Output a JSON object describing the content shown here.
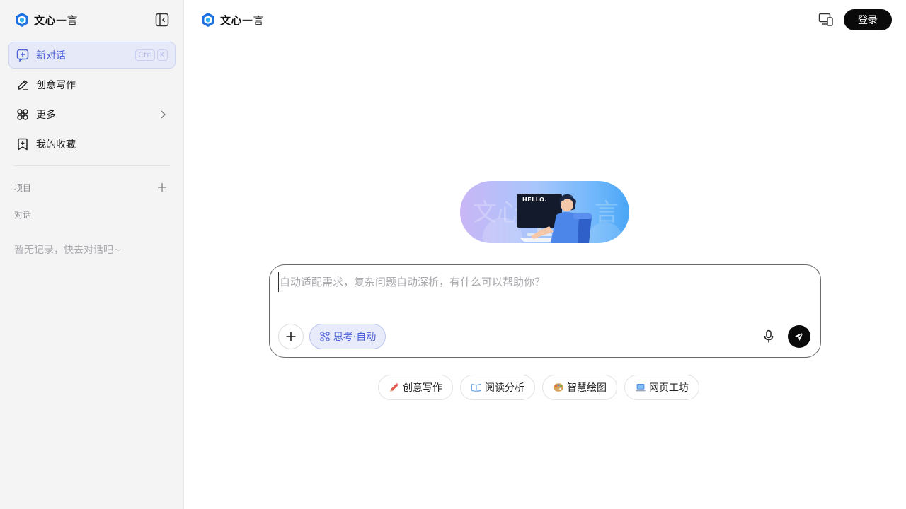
{
  "brand": {
    "name_bold": "文心",
    "name_light": "一言"
  },
  "sidebar": {
    "items": [
      {
        "label": "新对话",
        "icon": "new-chat-icon",
        "shortcut": [
          "Ctrl",
          "K"
        ]
      },
      {
        "label": "创意写作",
        "icon": "pen-icon"
      },
      {
        "label": "更多",
        "icon": "command-icon"
      },
      {
        "label": "我的收藏",
        "icon": "bookmark-add-icon"
      }
    ],
    "projects_label": "项目",
    "chats_label": "对话",
    "empty_text": "暂无记录，快去对话吧~"
  },
  "header": {
    "login_label": "登录"
  },
  "hero": {
    "speech_text": "HELLO."
  },
  "composer": {
    "placeholder": "自动适配需求，复杂问题自动深析，有什么可以帮助你？",
    "mode_label": "思考·自动"
  },
  "suggestions": [
    {
      "label": "创意写作",
      "icon": "pencil-emoji-icon"
    },
    {
      "label": "阅读分析",
      "icon": "book-emoji-icon"
    },
    {
      "label": "智慧绘图",
      "icon": "palette-emoji-icon"
    },
    {
      "label": "网页工坊",
      "icon": "laptop-emoji-icon"
    }
  ],
  "colors": {
    "accent": "#4b5fd6",
    "active_bg": "#e6e9f7",
    "sidebar_bg": "#f4f4f5",
    "button_dark": "#0a0a0a"
  }
}
